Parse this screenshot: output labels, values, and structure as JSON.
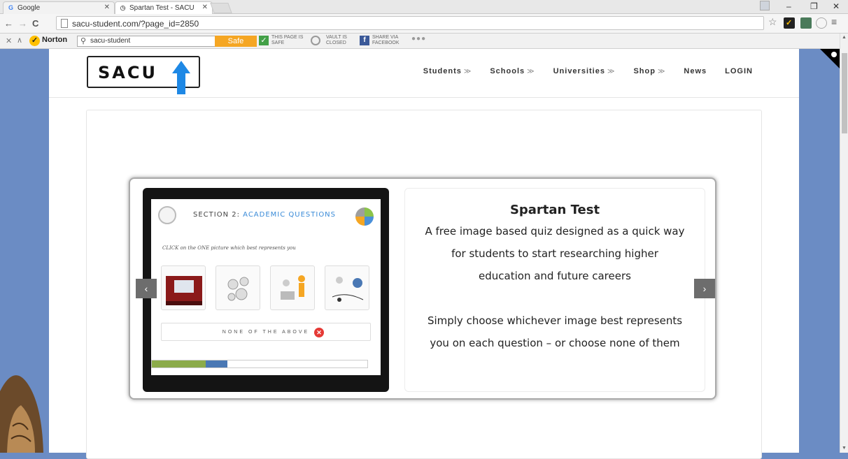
{
  "browser": {
    "tabs": [
      {
        "title": "Google",
        "favicon": "G"
      },
      {
        "title": "Spartan Test - SACU",
        "favicon": "◷"
      }
    ],
    "url": "sacu-student.com/?page_id=2850"
  },
  "norton": {
    "logo_text": "Norton",
    "search_value": "sacu-student",
    "safe_search_label": "Safe Search",
    "page_safe_line1": "THIS PAGE IS",
    "page_safe_line2": "SAFE",
    "vault_line1": "VAULT IS",
    "vault_line2": "CLOSED",
    "share_line1": "SHARE VIA",
    "share_line2": "FACEBOOK"
  },
  "site": {
    "logo_text": "SACU",
    "nav": [
      {
        "label": "Students",
        "has_menu": true
      },
      {
        "label": "Schools",
        "has_menu": true
      },
      {
        "label": "Universities",
        "has_menu": true
      },
      {
        "label": "Shop",
        "has_menu": true
      },
      {
        "label": "News",
        "has_menu": false
      },
      {
        "label": "LOGIN",
        "has_menu": false
      }
    ],
    "nav_chevron": "≫"
  },
  "slide": {
    "quiz": {
      "section_label": "SECTION 2:",
      "section_title": "ACADEMIC QUESTIONS",
      "instruction": "CLICK on the ONE picture which best represents you",
      "none_label": "NONE OF THE ABOVE",
      "progress_green": 0.25,
      "progress_blue": 0.1
    },
    "title": "Spartan Test",
    "lines": [
      "A free image based quiz designed as a quick way",
      "for students to start researching higher",
      "education and future careers",
      "",
      "Simply choose whichever image best represents",
      "you on each question – or choose none of them"
    ],
    "prev_label": "‹",
    "next_label": "›"
  },
  "colors": {
    "background_blue": "#6b8cc4",
    "safe_search_orange": "#f5a623",
    "logo_arrow_blue": "#1e88e5"
  }
}
